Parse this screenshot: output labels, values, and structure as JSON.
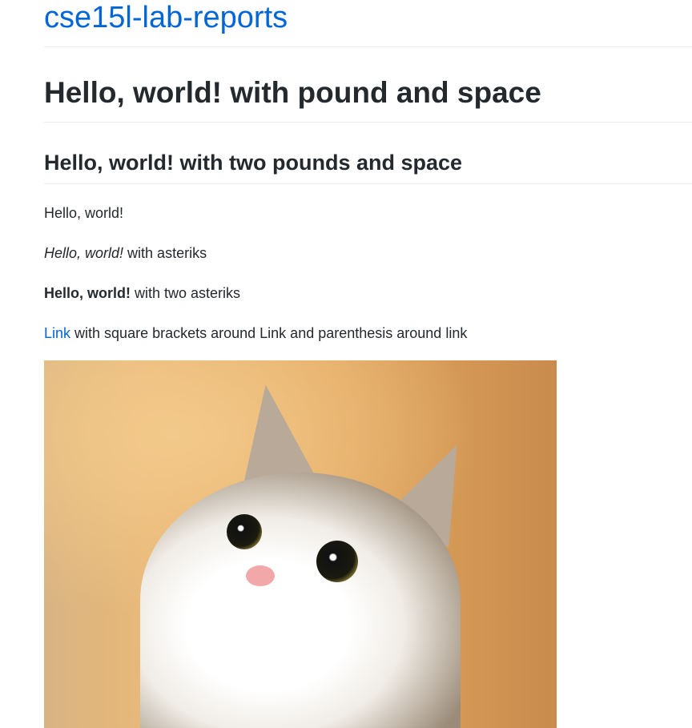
{
  "site": {
    "title": "cse15l-lab-reports"
  },
  "content": {
    "h1": "Hello, world! with pound and space",
    "h2": "Hello, world! with two pounds and space",
    "p1": "Hello, world!",
    "p2_em": "Hello, world!",
    "p2_rest": " with asteriks",
    "p3_strong": "Hello, world!",
    "p3_rest": " with two asteriks",
    "p4_link": "Link",
    "p4_rest": " with square brackets around Link and parenthesis around link"
  },
  "colors": {
    "link": "#0366d6",
    "text": "#24292e",
    "rule": "#eaecef"
  }
}
